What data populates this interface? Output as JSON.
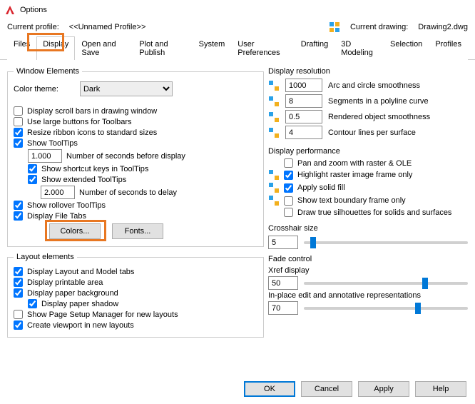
{
  "window": {
    "title": "Options"
  },
  "profile": {
    "label": "Current profile:",
    "value": "<<Unnamed Profile>>",
    "drawing_label": "Current drawing:",
    "drawing_value": "Drawing2.dwg"
  },
  "tabs": [
    "Files",
    "Display",
    "Open and Save",
    "Plot and Publish",
    "System",
    "User Preferences",
    "Drafting",
    "3D Modeling",
    "Selection",
    "Profiles"
  ],
  "window_elements": {
    "legend": "Window Elements",
    "color_theme_label": "Color theme:",
    "color_theme_value": "Dark",
    "scrollbars": "Display scroll bars in drawing window",
    "large_buttons": "Use large buttons for Toolbars",
    "resize_ribbon": "Resize ribbon icons to standard sizes",
    "show_tooltips": "Show ToolTips",
    "tooltip_seconds_value": "1.000",
    "tooltip_seconds_label": "Number of seconds before display",
    "shortcut_keys": "Show shortcut keys in ToolTips",
    "extended_tooltips": "Show extended ToolTips",
    "extended_seconds_value": "2.000",
    "extended_seconds_label": "Number of seconds to delay",
    "rollover": "Show rollover ToolTips",
    "file_tabs": "Display File Tabs",
    "colors_btn": "Colors...",
    "fonts_btn": "Fonts..."
  },
  "layout_elements": {
    "legend": "Layout elements",
    "layout_tabs": "Display Layout and Model tabs",
    "printable": "Display printable area",
    "paper_bg": "Display paper background",
    "paper_shadow": "Display paper shadow",
    "page_setup": "Show Page Setup Manager for new layouts",
    "viewport": "Create viewport in new layouts"
  },
  "display_resolution": {
    "legend": "Display resolution",
    "arc_value": "1000",
    "arc_label": "Arc and circle smoothness",
    "seg_value": "8",
    "seg_label": "Segments in a polyline curve",
    "rend_value": "0.5",
    "rend_label": "Rendered object smoothness",
    "cont_value": "4",
    "cont_label": "Contour lines per surface"
  },
  "display_performance": {
    "legend": "Display performance",
    "pan_zoom": "Pan and zoom with raster & OLE",
    "highlight": "Highlight raster image frame only",
    "solid_fill": "Apply solid fill",
    "text_boundary": "Show text boundary frame only",
    "silhouettes": "Draw true silhouettes for solids and surfaces"
  },
  "crosshair": {
    "legend": "Crosshair size",
    "value": "5"
  },
  "fade": {
    "legend": "Fade control",
    "xref_label": "Xref display",
    "xref_value": "50",
    "inplace_label": "In-place edit and annotative representations",
    "inplace_value": "70"
  },
  "buttons": {
    "ok": "OK",
    "cancel": "Cancel",
    "apply": "Apply",
    "help": "Help"
  }
}
